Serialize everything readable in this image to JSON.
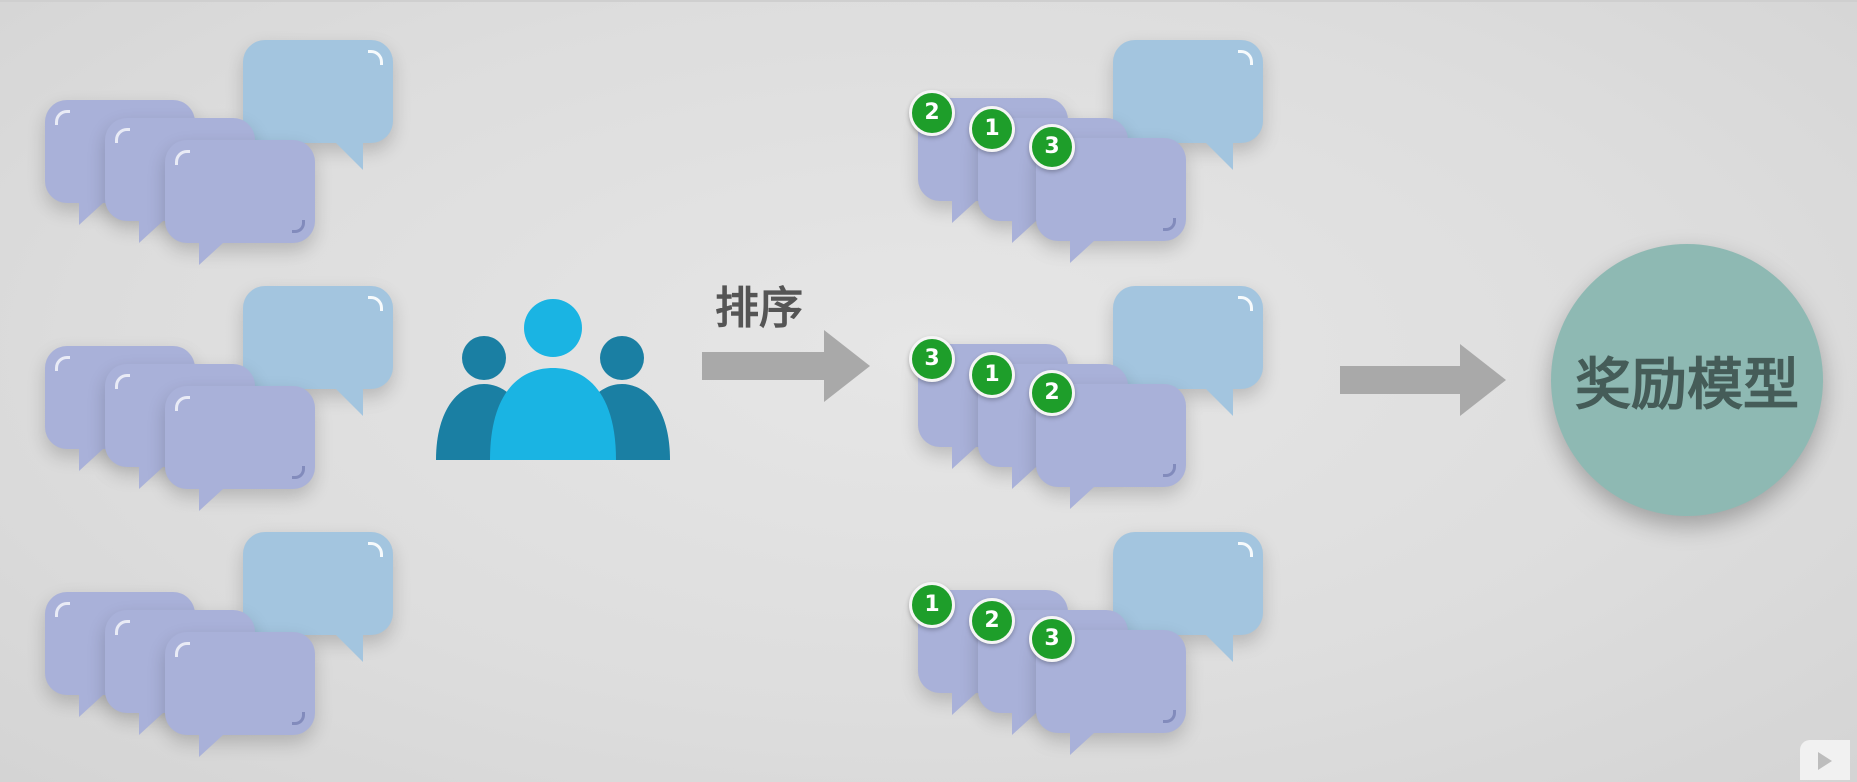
{
  "labels": {
    "sort": "排序",
    "model": "奖励模型"
  },
  "ranked_groups": [
    {
      "ranks": [
        "2",
        "1",
        "3"
      ]
    },
    {
      "ranks": [
        "3",
        "1",
        "2"
      ]
    },
    {
      "ranks": [
        "1",
        "2",
        "3"
      ]
    }
  ],
  "colors": {
    "bubble_front": "#a9b1d9",
    "bubble_back": "#a3c5df",
    "badge": "#1e9e2a",
    "people_center": "#1ab4e3",
    "people_side": "#1a7fa3",
    "arrow": "#a9a9a9",
    "model_circle": "#8eb9b3"
  },
  "icons": [
    "speech-bubble-icon",
    "people-group-icon",
    "right-arrow-icon",
    "play-logo-icon"
  ]
}
